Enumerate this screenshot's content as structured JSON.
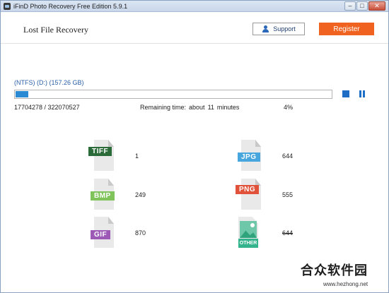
{
  "window": {
    "title": "iFinD Photo Recovery Free Edition 5.9.1",
    "controls": {
      "minimize": "–",
      "maximize": "□",
      "close": "✕"
    }
  },
  "header": {
    "title": "Lost File Recovery",
    "support_label": "Support",
    "register_label": "Register",
    "register_color": "#f0621f"
  },
  "scan": {
    "drive_label": "(NTFS) (D:) (157.26 GB)",
    "progress_fraction": 0.04,
    "sectors": "17704278 / 322070527",
    "remaining_label": "Remaining time:",
    "remaining_about": "about",
    "remaining_value": "11",
    "remaining_unit": "minutes",
    "percent": "4%"
  },
  "file_types": [
    {
      "name": "TIFF",
      "count": "1",
      "color": "#2b6b3a"
    },
    {
      "name": "JPG",
      "count": "644",
      "color": "#47a6dd"
    },
    {
      "name": "BMP",
      "count": "249",
      "color": "#7fc35a"
    },
    {
      "name": "PNG",
      "count": "555",
      "color": "#e0533a"
    },
    {
      "name": "GIF",
      "count": "870",
      "color": "#9c59b6"
    },
    {
      "name": "OTHER",
      "count": "644",
      "color": "#34b48c"
    }
  ],
  "watermark": {
    "main": "合众软件园",
    "sub": "www.hezhong.net"
  }
}
